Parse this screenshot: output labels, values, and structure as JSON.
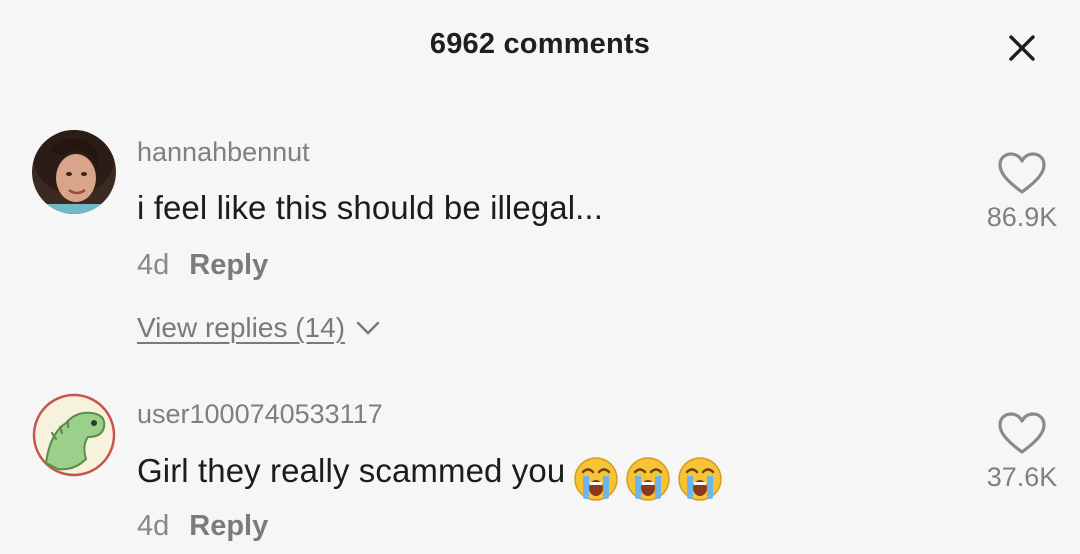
{
  "header": {
    "title": "6962 comments"
  },
  "comments": [
    {
      "username": "hannahbennut",
      "text": "i feel like this should be illegal...",
      "time": "4d",
      "reply_label": "Reply",
      "view_replies": "View replies (14)",
      "likes": "86.9K"
    },
    {
      "username": "user1000740533117",
      "text": "Girl they really scammed you",
      "emojis": [
        "loudly-crying-face",
        "loudly-crying-face",
        "loudly-crying-face"
      ],
      "time": "4d",
      "reply_label": "Reply",
      "likes": "37.6K"
    }
  ],
  "colors": {
    "background": "#f6f6f6",
    "text_primary": "#1c1c1c",
    "text_secondary": "#7f7f7f"
  }
}
